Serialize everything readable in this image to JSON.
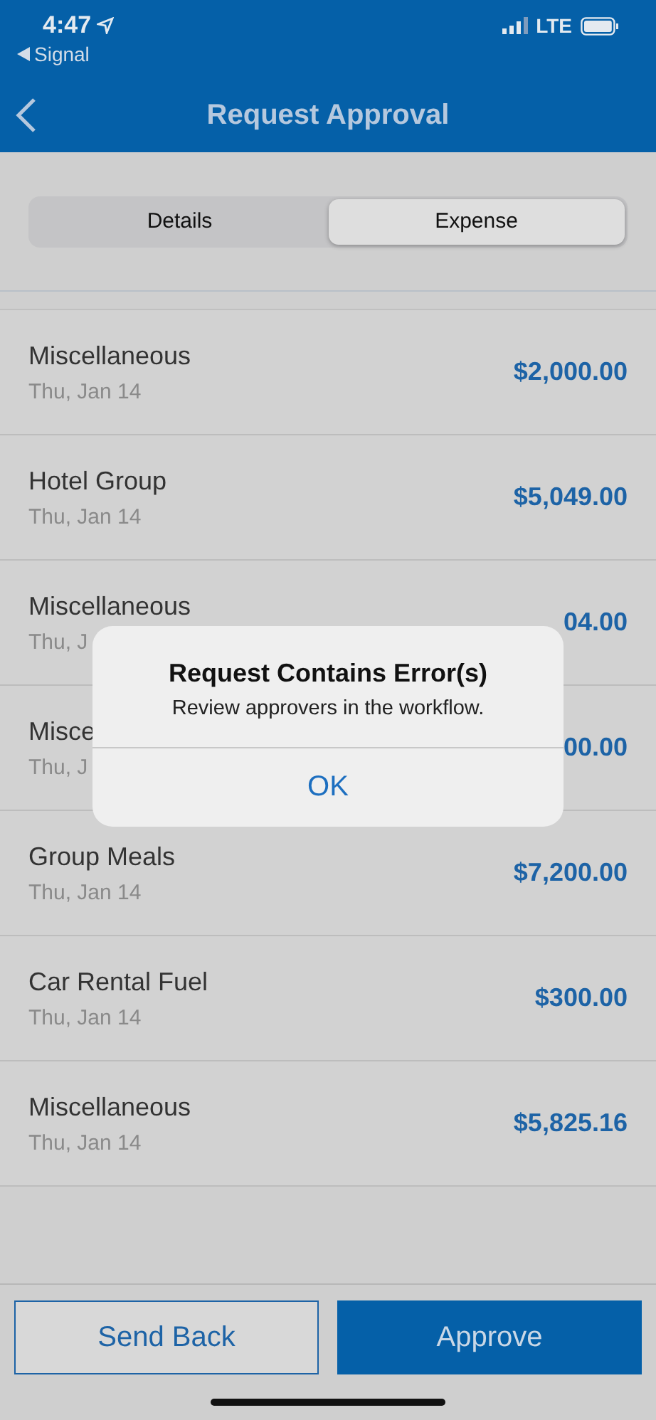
{
  "status_bar": {
    "time": "4:47",
    "back_app": "Signal",
    "network": "LTE"
  },
  "nav_bar": {
    "title": "Request Approval"
  },
  "tabs": [
    {
      "label": "Details",
      "selected": false
    },
    {
      "label": "Expense",
      "selected": true
    }
  ],
  "expenses": [
    {
      "name": "Miscellaneous",
      "date": "Thu, Jan 14",
      "amount": "$2,000.00"
    },
    {
      "name": "Hotel Group",
      "date": "Thu, Jan 14",
      "amount": "$5,049.00"
    },
    {
      "name": "Miscellaneous",
      "date": "Thu, J",
      "amount": "04.00"
    },
    {
      "name": "Misce",
      "date": "Thu, J",
      "amount": "00.00"
    },
    {
      "name": "Group Meals",
      "date": "Thu, Jan 14",
      "amount": "$7,200.00"
    },
    {
      "name": "Car Rental Fuel",
      "date": "Thu, Jan 14",
      "amount": "$300.00"
    },
    {
      "name": "Miscellaneous",
      "date": "Thu, Jan 14",
      "amount": "$5,825.16"
    }
  ],
  "dialog": {
    "title": "Request Contains Error(s)",
    "message": "Review approvers in the workflow.",
    "button": "OK"
  },
  "actions": [
    {
      "label": "Send Back",
      "kind": "outline"
    },
    {
      "label": "Approve",
      "kind": "filled"
    }
  ]
}
